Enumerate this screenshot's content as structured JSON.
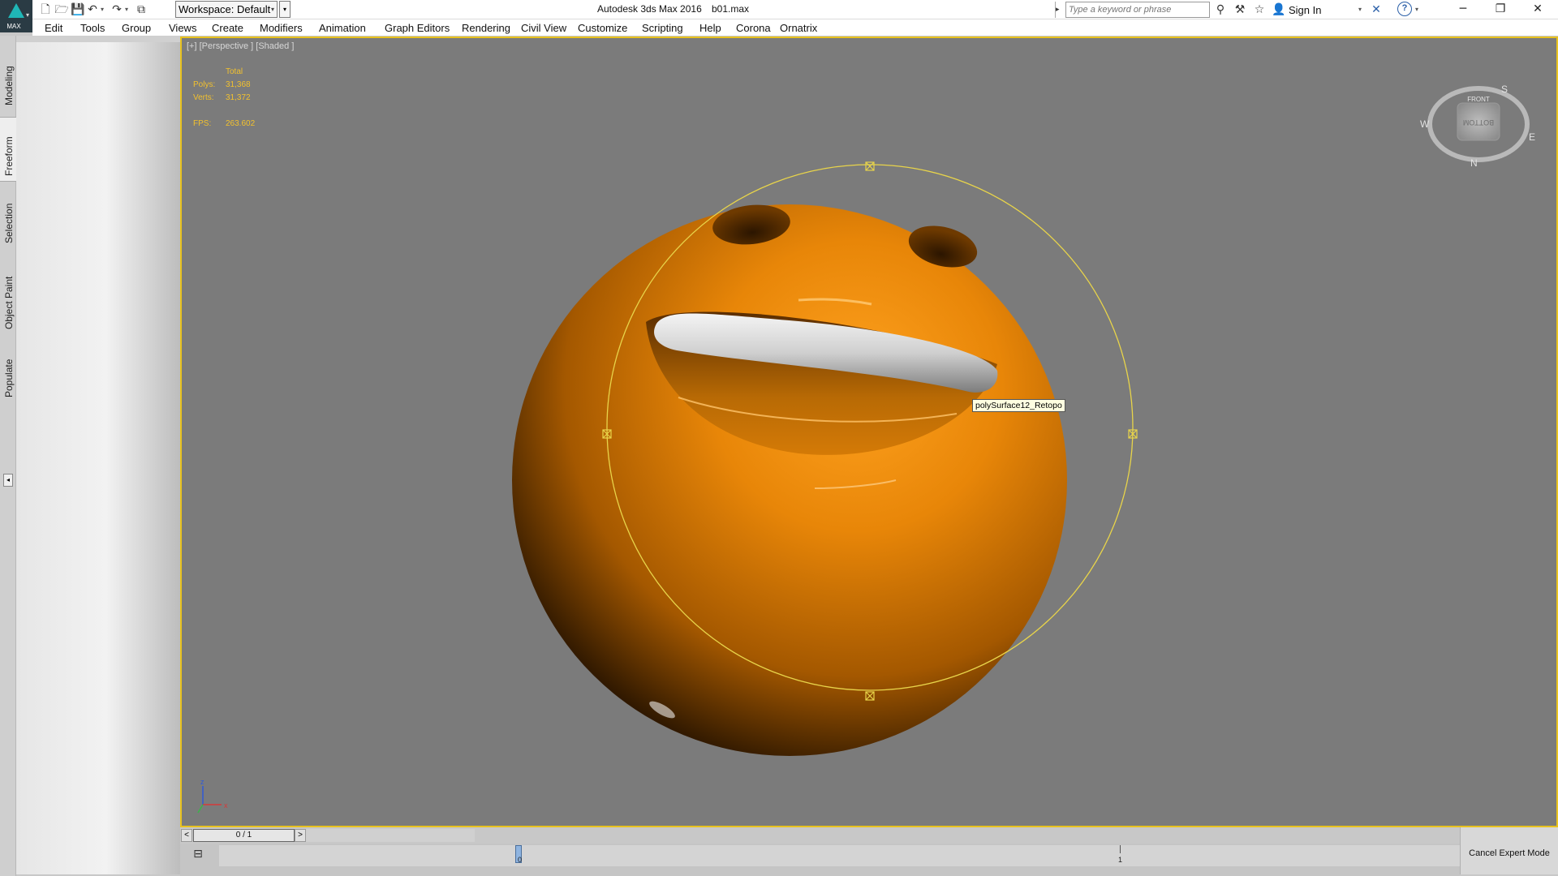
{
  "app": {
    "title": "Autodesk 3ds Max 2016",
    "file": "b01.max",
    "logo_text": "MAX"
  },
  "toolbar": {
    "workspace_label": "Workspace: Default",
    "search_placeholder": "Type a keyword or phrase",
    "signin_label": "Sign In"
  },
  "menu": {
    "items": [
      {
        "label": "Edit"
      },
      {
        "label": "Tools"
      },
      {
        "label": "Group"
      },
      {
        "label": "Views"
      },
      {
        "label": "Create"
      },
      {
        "label": "Modifiers"
      },
      {
        "label": "Animation"
      },
      {
        "label": "Graph Editors"
      },
      {
        "label": "Rendering"
      },
      {
        "label": "Civil View"
      },
      {
        "label": "Customize"
      },
      {
        "label": "Scripting"
      },
      {
        "label": "Help"
      },
      {
        "label": "Corona"
      },
      {
        "label": "Ornatrix"
      }
    ]
  },
  "ribbon": {
    "tabs": [
      {
        "label": "Modeling",
        "active": false
      },
      {
        "label": "Freeform",
        "active": true
      },
      {
        "label": "Selection",
        "active": false
      },
      {
        "label": "Object Paint",
        "active": false
      },
      {
        "label": "Populate",
        "active": false
      }
    ]
  },
  "viewport": {
    "label": "[+] [Perspective ] [Shaded ]",
    "stats": {
      "total_label": "Total",
      "polys_label": "Polys:",
      "polys_value": "31,368",
      "verts_label": "Verts:",
      "verts_value": "31,372",
      "fps_label": "FPS:",
      "fps_value": "263.602"
    },
    "tooltip": "polySurface12_Retopo",
    "viewcube": {
      "face_top": "FRONT",
      "face_main": "BOTTOM",
      "compass_n": "N",
      "compass_s": "S",
      "compass_e": "E",
      "compass_w": "W"
    },
    "axis": {
      "x": "x",
      "z": "z"
    },
    "colors": {
      "background": "#7b7b7b",
      "border": "#e8c21e",
      "stats": "#f2c12e",
      "object": "#c46f06"
    }
  },
  "timeline": {
    "slider_label": "0 / 1",
    "prev": "<",
    "next": ">",
    "frame_0": "0",
    "frame_1": "1"
  },
  "status": {
    "cancel_expert_label": "Cancel Expert Mode"
  }
}
